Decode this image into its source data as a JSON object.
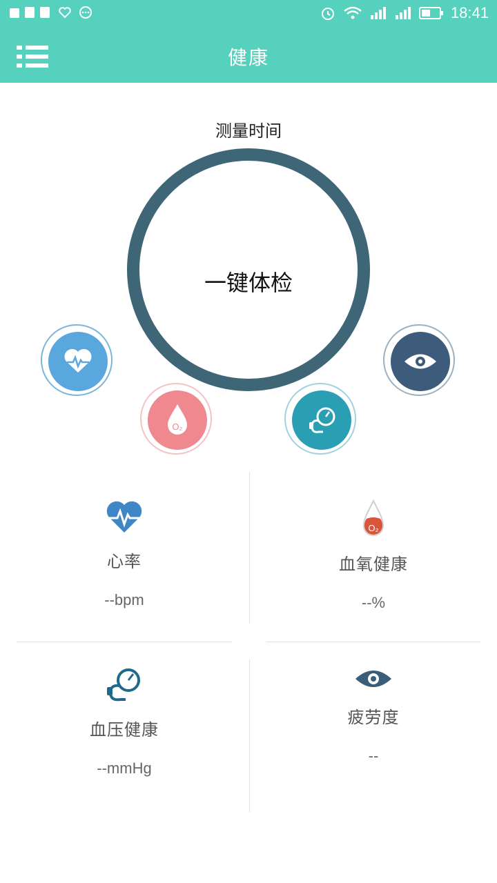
{
  "status_bar": {
    "time": "18:41"
  },
  "app_bar": {
    "title": "健康"
  },
  "measure": {
    "time_label": "测量时间",
    "button_label": "一键体检"
  },
  "colors": {
    "accent": "#56d1bd",
    "ring": "#3f6677",
    "heart": "#5aa7dd",
    "oxygen": "#f0888f",
    "pressure": "#2a9fb4",
    "fatigue": "#3d5c7b"
  },
  "metrics": [
    {
      "name": "心率",
      "value": "--bpm",
      "icon": "heart-rate-icon"
    },
    {
      "name": "血氧健康",
      "value": "--%",
      "icon": "blood-oxygen-icon"
    },
    {
      "name": "血压健康",
      "value": "--mmHg",
      "icon": "blood-pressure-icon"
    },
    {
      "name": "疲劳度",
      "value": "--",
      "icon": "eye-icon"
    }
  ]
}
